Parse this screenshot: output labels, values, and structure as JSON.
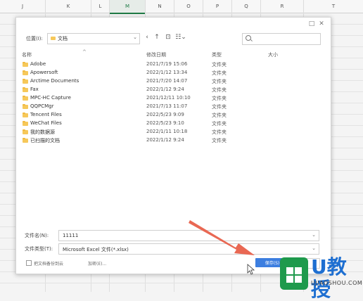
{
  "sheet": {
    "columns": [
      "J",
      "K",
      "L",
      "M",
      "N",
      "O",
      "P",
      "Q",
      "R",
      "T"
    ],
    "active_column": "M"
  },
  "dialog": {
    "location_label": "位置(I):",
    "location_value": "文档",
    "search_placeholder": "",
    "headers": {
      "name": "名称",
      "date": "修改日期",
      "type": "类型",
      "size": "大小"
    },
    "files": [
      {
        "name": "Adobe",
        "date": "2021/7/19 15:06",
        "type": "文件夹"
      },
      {
        "name": "Apowersoft",
        "date": "2022/1/12 13:34",
        "type": "文件夹"
      },
      {
        "name": "Arctime Documents",
        "date": "2021/7/20 14:07",
        "type": "文件夹"
      },
      {
        "name": "Fax",
        "date": "2022/1/12 9:24",
        "type": "文件夹"
      },
      {
        "name": "MPC-HC Capture",
        "date": "2021/12/11 10:10",
        "type": "文件夹"
      },
      {
        "name": "QQPCMgr",
        "date": "2021/7/13 11:07",
        "type": "文件夹"
      },
      {
        "name": "Tencent Files",
        "date": "2022/5/23 9:09",
        "type": "文件夹"
      },
      {
        "name": "WeChat Files",
        "date": "2022/5/23 9:10",
        "type": "文件夹"
      },
      {
        "name": "我的数据源",
        "date": "2022/1/11 10:18",
        "type": "文件夹"
      },
      {
        "name": "已扫描的文档",
        "date": "2022/1/12 9:24",
        "type": "文件夹"
      }
    ],
    "filename_label": "文件名(N):",
    "filename_value": "11111",
    "filetype_label": "文件类型(T):",
    "filetype_value": "Microsoft Excel 文件(*.xlsx)",
    "backup_label": "把文档备份到云",
    "encrypt_label": "加密(E)...",
    "save_label": "保存(S)"
  },
  "watermark": {
    "brand": "U教授",
    "site": "UJIAOSHOU.COM"
  },
  "colors": {
    "accent": "#3c7ee0",
    "arrow": "#e8604a",
    "brand_green": "#1e9a4c",
    "brand_blue": "#1e6fd1"
  }
}
